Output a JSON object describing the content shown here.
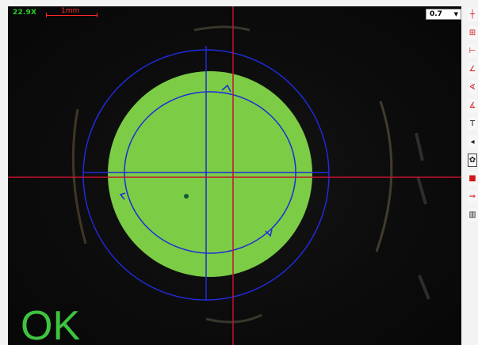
{
  "viewer": {
    "magnification": "22.9X",
    "scale_bar_label": "1mm",
    "zoom_value": "0.7",
    "result_text": "OK",
    "colors": {
      "measurement_fill": "#7ccc46",
      "circle_outline": "#1f2bd9",
      "crosshair": "#c8102e",
      "result_text": "#3ec43e"
    },
    "crosshair_sets": 2
  },
  "toolbar": {
    "tools": [
      {
        "icon": "crosshair-icon",
        "glyph": "┼"
      },
      {
        "icon": "grid-icon",
        "glyph": "⊞"
      },
      {
        "icon": "line-measure-icon",
        "glyph": "⊢"
      },
      {
        "icon": "angle-icon",
        "glyph": "∠"
      },
      {
        "icon": "angle-three-point-icon",
        "glyph": "∢"
      },
      {
        "icon": "angle-arc-icon",
        "glyph": "∡"
      },
      {
        "icon": "text-icon",
        "glyph": "T"
      },
      {
        "icon": "cursor-icon",
        "glyph": "◂"
      },
      {
        "icon": "settings-icon",
        "glyph": "✿"
      },
      {
        "icon": "record-icon",
        "glyph": "■"
      },
      {
        "icon": "export-icon",
        "glyph": "⇒"
      },
      {
        "icon": "barcode-icon",
        "glyph": "▥"
      }
    ]
  }
}
